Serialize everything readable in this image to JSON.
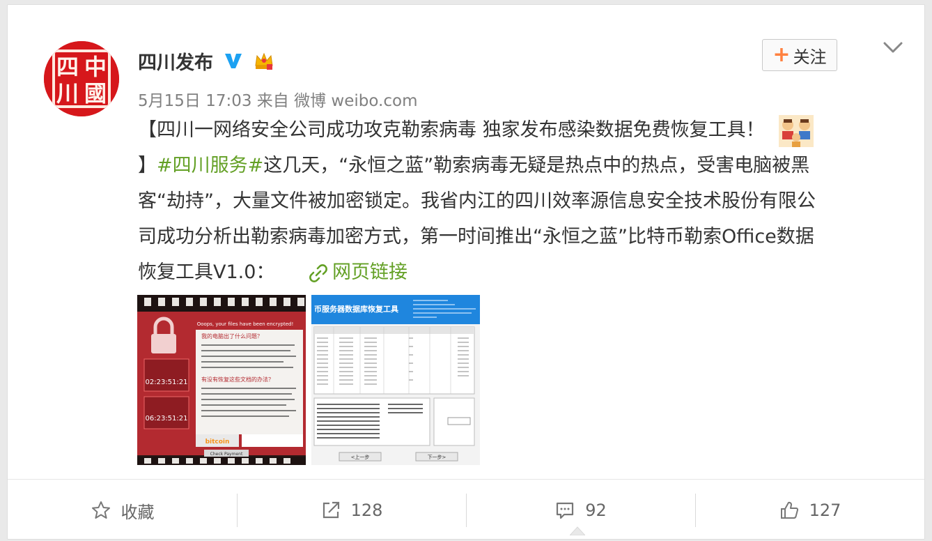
{
  "post": {
    "author": "四川发布",
    "avatar_text": [
      "四",
      "川",
      "中",
      "國"
    ],
    "meta": "5月15日 17:03 来自 微博 weibo.com",
    "follow_label": "关注",
    "follow_plus": "+",
    "lines": [
      {
        "parts": [
          {
            "text": "【四川一网络安全公司成功攻克勒索病毒 独家发布感染数据免费恢复工具！"
          }
        ]
      },
      {
        "parts": [
          {
            "text": "】"
          },
          {
            "text": "#四川服务#",
            "topic": true
          },
          {
            "text": "这几天，“永恒之蓝”勒索病毒无疑是热点中的热点，受害电脑被黑"
          }
        ]
      },
      {
        "parts": [
          {
            "text": "客“劫持”，大量文件被加密锁定。我省内江的四川效率源信息安全技术股份有限公"
          }
        ]
      },
      {
        "parts": [
          {
            "text": "司成功分析出勒索病毒加密方式，第一时间推出“永恒之蓝”比特币勒索Office数据"
          }
        ]
      },
      {
        "parts": [
          {
            "text": "恢复工具V1.0："
          }
        ]
      }
    ],
    "link_label": "网页链接",
    "photo1": {
      "banner": "Ooops, your files have been encrypted!",
      "heading1": "我的电脑出了什么问题？",
      "heading2": "有没有恢复这些文档的办法？",
      "timer1": "02:23:51:21",
      "timer2": "06:23:51:21",
      "bitcoin": "bitcoin",
      "check_btn": "Check Payment"
    },
    "photo2": {
      "title": "币服务器数据库恢复工具",
      "prev_btn": "<上一步",
      "next_btn": "下一步>"
    }
  },
  "toolbar": {
    "favorite": "收藏",
    "repost_count": "128",
    "comment_count": "92",
    "like_count": "127"
  },
  "colors": {
    "topic": "#63a025",
    "follow_plus": "#ff8140",
    "verified": "#1ca1f2",
    "avatar": "#d6171b"
  }
}
